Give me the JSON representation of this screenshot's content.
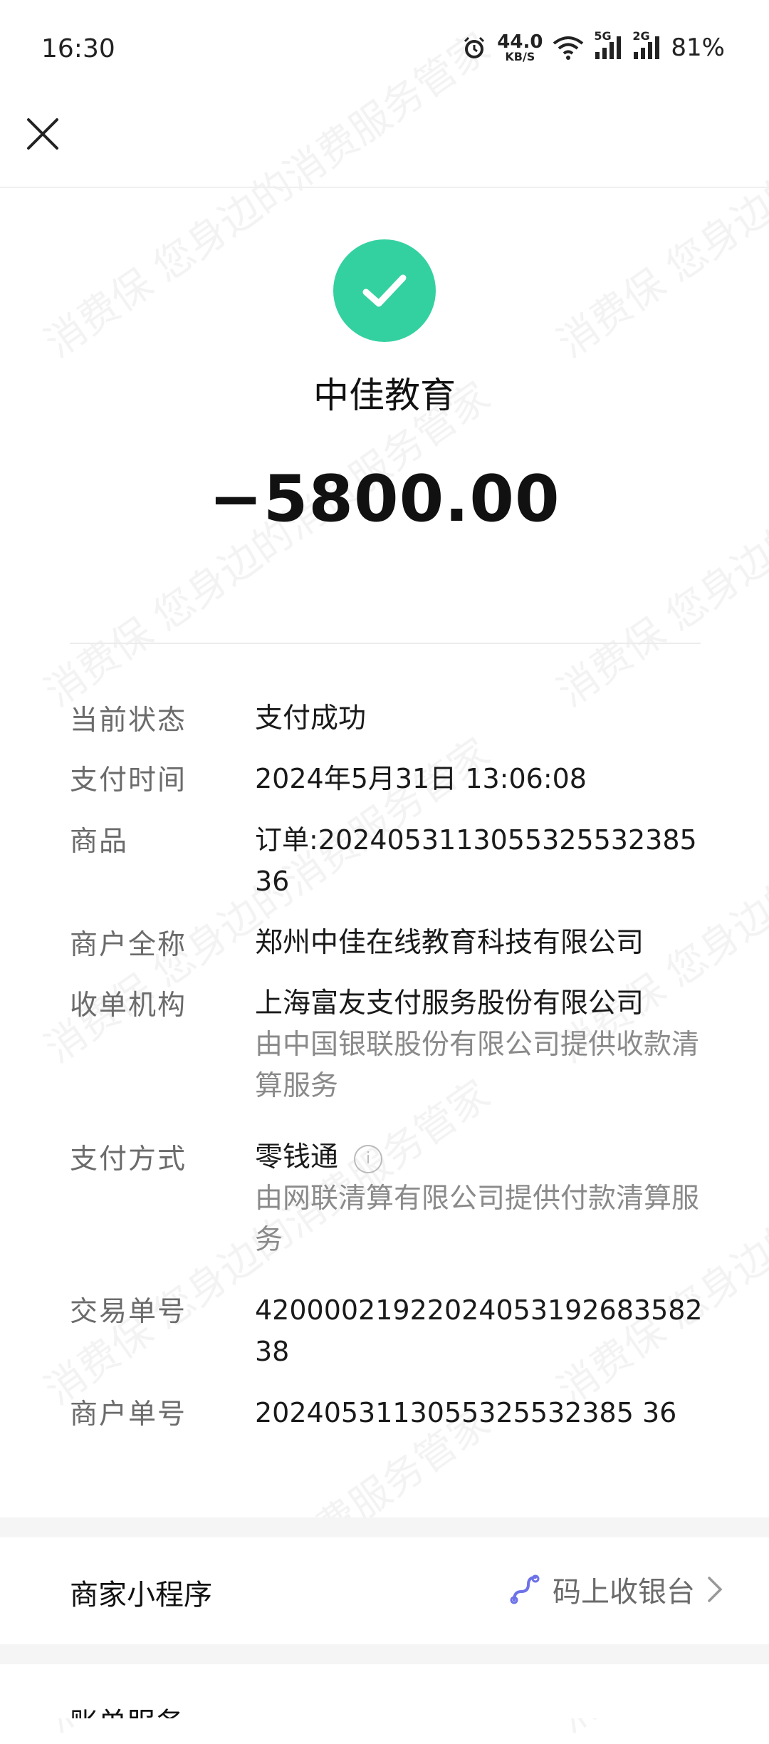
{
  "status_bar": {
    "time": "16:30",
    "net_speed": "44.0",
    "net_unit": "KB/S",
    "sig1_label": "5G",
    "sig2_label": "2G",
    "battery": "81%"
  },
  "header": {
    "close_icon": "close-icon"
  },
  "payment": {
    "status_icon": "check-icon",
    "merchant_name": "中佳教育",
    "amount": "−5800.00",
    "accent_color": "#34d1a0"
  },
  "details": [
    {
      "label": "当前状态",
      "value": "支付成功"
    },
    {
      "label": "支付时间",
      "value": "2024年5月31日 13:06:08"
    },
    {
      "label": "商品",
      "value": "订单:20240531130553255323853​6"
    },
    {
      "label": "商户全称",
      "value": "郑州中佳在线教育科技有限公司"
    },
    {
      "label": "收单机构",
      "value": "上海富友支付服务股份有限公司",
      "note": "由中国银联股份有限公司提供收款清算服务"
    },
    {
      "label": "支付方式",
      "value": "零钱通",
      "note": "由网联清算有限公司提供付款清算服务"
    },
    {
      "label": "交易单号",
      "value": "42000021922024053192683582 38"
    },
    {
      "label": "商户单号",
      "value": "2024053113055325532385 36"
    }
  ],
  "merchant_mini_program": {
    "label": "商家小程序",
    "link_text": "码上收银台"
  },
  "bill_service": {
    "label": "账单服务"
  },
  "watermark_text": "消费保 您身边的消费服务管家"
}
